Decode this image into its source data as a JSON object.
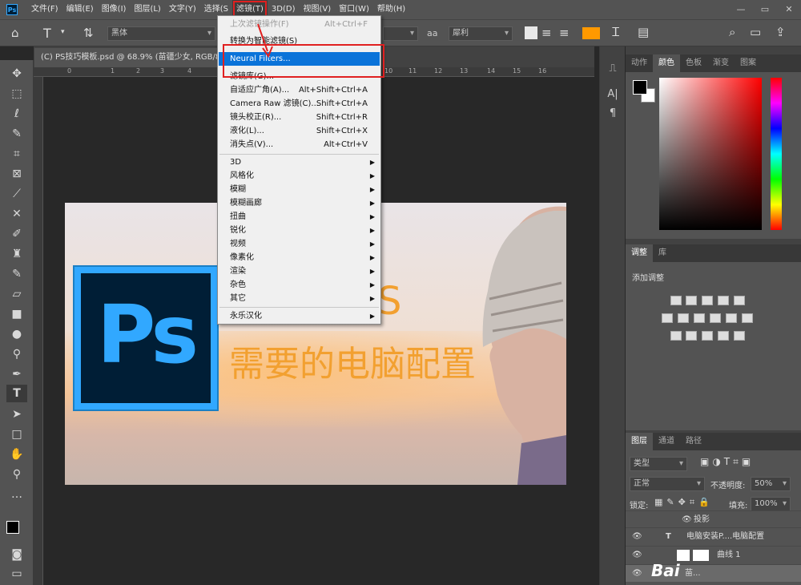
{
  "menubar": {
    "items": [
      "文件(F)",
      "编辑(E)",
      "图像(I)",
      "图层(L)",
      "文字(Y)",
      "选择(S",
      "滤镜(T)",
      "3D(D)",
      "视图(V)",
      "窗口(W)",
      "帮助(H)"
    ],
    "active_index": 6
  },
  "window_buttons": [
    "—",
    "▭",
    "✕"
  ],
  "options": {
    "font_family": "黑体",
    "antialias_label": "aa",
    "antialias": "犀利"
  },
  "doc_tab": "(C) PS技巧模板.psd @ 68.9% (苗疆少女, RGB/8",
  "ruler_numbers": [
    "0",
    "1",
    "2",
    "3",
    "4",
    "10",
    "11",
    "12",
    "13",
    "14",
    "15",
    "16"
  ],
  "image": {
    "headline": "需要的电脑配置",
    "partial_text": "S",
    "logo_text": "Ps"
  },
  "filter_menu": {
    "items": [
      {
        "label": "上次滤镜操作(F)",
        "shortcut": "Alt+Ctrl+F",
        "disabled": true
      },
      {
        "label": "转换为智能滤镜(S)",
        "shortcut": ""
      },
      {
        "label": "Neural Filters...",
        "shortcut": "",
        "highlighted": true
      },
      {
        "label": "滤镜库(G)...",
        "shortcut": ""
      },
      {
        "label": "自适应广角(A)...",
        "shortcut": "Alt+Shift+Ctrl+A"
      },
      {
        "label": "Camera Raw 滤镜(C)...",
        "shortcut": "Shift+Ctrl+A"
      },
      {
        "label": "镜头校正(R)...",
        "shortcut": "Shift+Ctrl+R"
      },
      {
        "label": "液化(L)...",
        "shortcut": "Shift+Ctrl+X"
      },
      {
        "label": "消失点(V)...",
        "shortcut": "Alt+Ctrl+V"
      },
      {
        "label": "3D",
        "submenu": true
      },
      {
        "label": "风格化",
        "submenu": true
      },
      {
        "label": "模糊",
        "submenu": true
      },
      {
        "label": "模糊画廊",
        "submenu": true
      },
      {
        "label": "扭曲",
        "submenu": true
      },
      {
        "label": "锐化",
        "submenu": true
      },
      {
        "label": "视频",
        "submenu": true
      },
      {
        "label": "像素化",
        "submenu": true
      },
      {
        "label": "渲染",
        "submenu": true
      },
      {
        "label": "杂色",
        "submenu": true
      },
      {
        "label": "其它",
        "submenu": true
      },
      {
        "label": "永乐汉化",
        "submenu": true
      }
    ]
  },
  "color_panel": {
    "tabs": [
      "动作",
      "颜色",
      "色板",
      "渐变",
      "图案"
    ],
    "active": 1,
    "fg_color": "#000000",
    "bg_color": "#ffffff"
  },
  "adjust_panel": {
    "tabs": [
      "调整",
      "库"
    ],
    "active": 0,
    "title": "添加调整"
  },
  "layers_panel": {
    "tabs": [
      "图层",
      "通道",
      "路径"
    ],
    "active": 0,
    "filter_kind": "类型",
    "blend_mode": "正常",
    "opacity_label": "不透明度:",
    "opacity": "50%",
    "lock_label": "锁定:",
    "fill_label": "填充:",
    "fill": "100%",
    "rows": [
      {
        "name": "投影",
        "type": "effect"
      },
      {
        "name": "电脑安装P....电脑配置",
        "type": "text"
      },
      {
        "name": "曲线 1",
        "type": "adjust"
      },
      {
        "name": "苗...",
        "type": "image"
      }
    ]
  },
  "watermark": "Bai"
}
